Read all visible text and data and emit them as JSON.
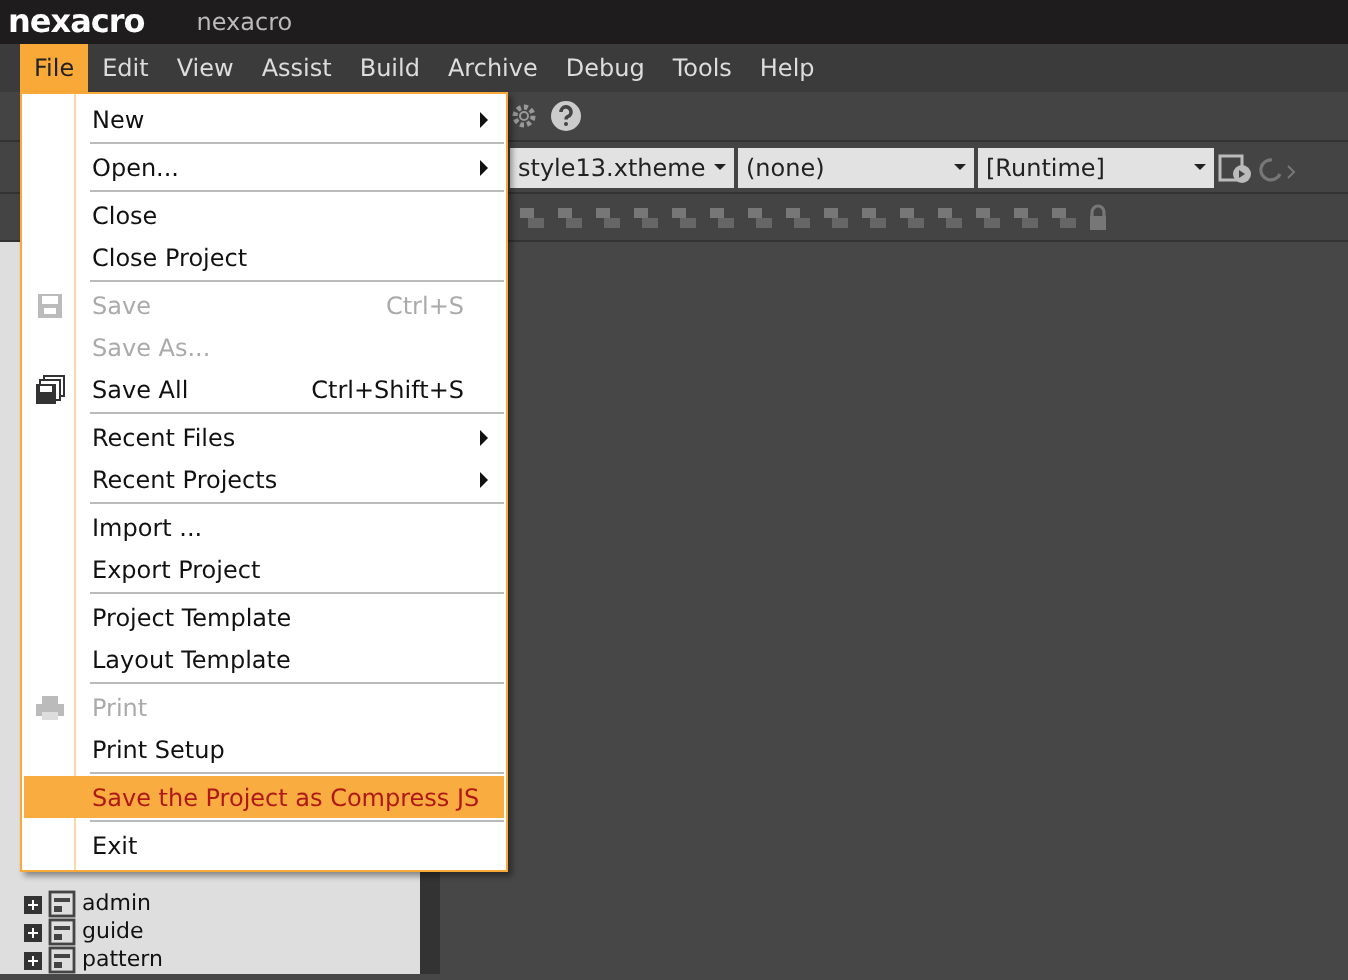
{
  "window": {
    "logo": "nexacro",
    "title": "nexacro"
  },
  "menu_bar": [
    {
      "label": "File",
      "selected": true
    },
    {
      "label": "Edit",
      "selected": false
    },
    {
      "label": "View",
      "selected": false
    },
    {
      "label": "Assist",
      "selected": false
    },
    {
      "label": "Build",
      "selected": false
    },
    {
      "label": "Archive",
      "selected": false
    },
    {
      "label": "Debug",
      "selected": false
    },
    {
      "label": "Tools",
      "selected": false
    },
    {
      "label": "Help",
      "selected": false
    }
  ],
  "toolbar": {
    "combos": [
      "style13.xtheme",
      "(none)",
      "[Runtime]"
    ]
  },
  "file_menu": [
    {
      "kind": "item",
      "label": "New",
      "submenu": true,
      "disabled": false,
      "highlighted": false
    },
    {
      "kind": "separator"
    },
    {
      "kind": "item",
      "label": "Open...",
      "submenu": true,
      "disabled": false,
      "highlighted": false
    },
    {
      "kind": "separator"
    },
    {
      "kind": "item",
      "label": "Close",
      "submenu": false,
      "disabled": false,
      "highlighted": false
    },
    {
      "kind": "item",
      "label": "Close Project",
      "submenu": false,
      "disabled": false,
      "highlighted": false
    },
    {
      "kind": "separator"
    },
    {
      "kind": "item",
      "label": "Save",
      "shortcut": "Ctrl+S",
      "submenu": false,
      "disabled": true,
      "highlighted": false
    },
    {
      "kind": "item",
      "label": "Save As...",
      "submenu": false,
      "disabled": true,
      "highlighted": false
    },
    {
      "kind": "item",
      "label": "Save All",
      "shortcut": "Ctrl+Shift+S",
      "submenu": false,
      "disabled": false,
      "highlighted": false
    },
    {
      "kind": "separator"
    },
    {
      "kind": "item",
      "label": "Recent Files",
      "submenu": true,
      "disabled": false,
      "highlighted": false
    },
    {
      "kind": "item",
      "label": "Recent Projects",
      "submenu": true,
      "disabled": false,
      "highlighted": false
    },
    {
      "kind": "separator"
    },
    {
      "kind": "item",
      "label": "Import ...",
      "submenu": false,
      "disabled": false,
      "highlighted": false
    },
    {
      "kind": "item",
      "label": "Export Project",
      "submenu": false,
      "disabled": false,
      "highlighted": false
    },
    {
      "kind": "separator"
    },
    {
      "kind": "item",
      "label": "Project Template",
      "submenu": false,
      "disabled": false,
      "highlighted": false
    },
    {
      "kind": "item",
      "label": "Layout Template",
      "submenu": false,
      "disabled": false,
      "highlighted": false
    },
    {
      "kind": "separator"
    },
    {
      "kind": "item",
      "label": "Print",
      "submenu": false,
      "disabled": true,
      "highlighted": false
    },
    {
      "kind": "item",
      "label": "Print Setup",
      "submenu": false,
      "disabled": false,
      "highlighted": false
    },
    {
      "kind": "separator"
    },
    {
      "kind": "item",
      "label": "Save the Project as Compress JS",
      "submenu": false,
      "disabled": false,
      "highlighted": true
    },
    {
      "kind": "separator"
    },
    {
      "kind": "item",
      "label": "Exit",
      "submenu": false,
      "disabled": false,
      "highlighted": false
    }
  ],
  "project_tree": [
    {
      "label": "admin",
      "expanded": false
    },
    {
      "label": "guide",
      "expanded": false
    },
    {
      "label": "pattern",
      "expanded": false
    }
  ]
}
